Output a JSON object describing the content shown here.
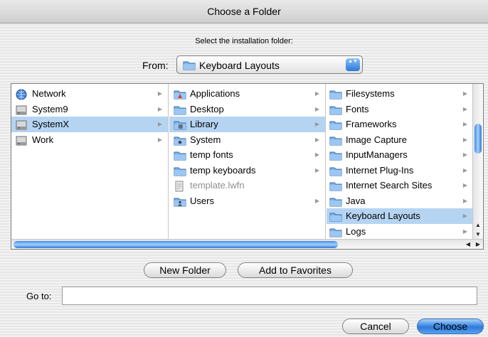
{
  "window": {
    "title": "Choose a Folder"
  },
  "prompt": "Select the installation folder:",
  "from": {
    "label": "From:",
    "value": "Keyboard Layouts",
    "arrows": "▲▼"
  },
  "columns": [
    {
      "items": [
        {
          "label": "Network",
          "icon": "network-globe-icon",
          "arrow": "▶",
          "selected": false
        },
        {
          "label": "System9",
          "icon": "hard-drive-icon",
          "arrow": "▶",
          "selected": false
        },
        {
          "label": "SystemX",
          "icon": "hard-drive-icon",
          "arrow": "▶",
          "selected": true
        },
        {
          "label": "Work",
          "icon": "hard-drive-icon",
          "arrow": "▶",
          "selected": false
        }
      ]
    },
    {
      "items": [
        {
          "label": "Applications",
          "icon": "applications-folder-icon",
          "arrow": "▶",
          "selected": false
        },
        {
          "label": "Desktop",
          "icon": "folder-icon",
          "arrow": "▶",
          "selected": false
        },
        {
          "label": "Library",
          "icon": "library-folder-icon",
          "arrow": "▶",
          "selected": true
        },
        {
          "label": "System",
          "icon": "system-folder-icon",
          "arrow": "▶",
          "selected": false
        },
        {
          "label": "temp fonts",
          "icon": "folder-icon",
          "arrow": "▶",
          "selected": false
        },
        {
          "label": "temp keyboards",
          "icon": "folder-icon",
          "arrow": "▶",
          "selected": false
        },
        {
          "label": "template.lwfn",
          "icon": "document-icon",
          "arrow": "",
          "selected": false,
          "dim": true
        },
        {
          "label": "Users",
          "icon": "users-folder-icon",
          "arrow": "▶",
          "selected": false
        }
      ]
    },
    {
      "items": [
        {
          "label": "Filesystems",
          "icon": "folder-icon",
          "arrow": "▶",
          "selected": false
        },
        {
          "label": "Fonts",
          "icon": "folder-icon",
          "arrow": "▶",
          "selected": false
        },
        {
          "label": "Frameworks",
          "icon": "folder-icon",
          "arrow": "▶",
          "selected": false
        },
        {
          "label": "Image Capture",
          "icon": "folder-icon",
          "arrow": "▶",
          "selected": false
        },
        {
          "label": "InputManagers",
          "icon": "folder-icon",
          "arrow": "▶",
          "selected": false
        },
        {
          "label": "Internet Plug-Ins",
          "icon": "folder-icon",
          "arrow": "▶",
          "selected": false
        },
        {
          "label": "Internet Search Sites",
          "icon": "folder-icon",
          "arrow": "▶",
          "selected": false
        },
        {
          "label": "Java",
          "icon": "folder-icon",
          "arrow": "▶",
          "selected": false
        },
        {
          "label": "Keyboard Layouts",
          "icon": "folder-icon",
          "arrow": "▶",
          "selected": true
        },
        {
          "label": "Logs",
          "icon": "folder-icon",
          "arrow": "▶",
          "selected": false
        }
      ]
    }
  ],
  "scroll": {
    "up": "▲",
    "down": "▼",
    "left": "◀",
    "right": "▶"
  },
  "buttons": {
    "new_folder": "New Folder",
    "add_favorites": "Add to Favorites",
    "cancel": "Cancel",
    "choose": "Choose"
  },
  "goto": {
    "label": "Go to:",
    "value": ""
  },
  "colors": {
    "selection": "#b5d4f2",
    "aqua_blue": "#2c7bdc",
    "folder": "#7eb2ec"
  }
}
